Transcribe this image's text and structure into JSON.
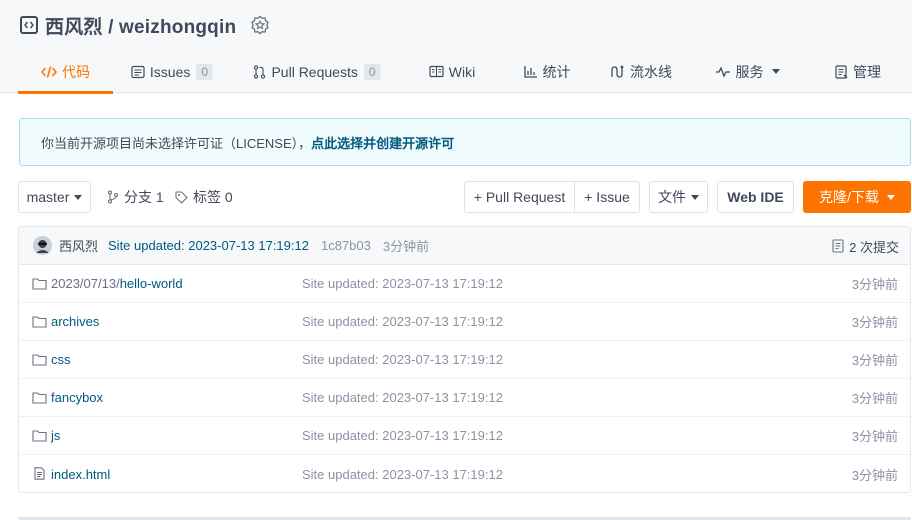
{
  "repo": {
    "title": "西风烈 / weizhongqin"
  },
  "tabs": [
    {
      "label": "代码",
      "icon": "code-icon",
      "active": true
    },
    {
      "label": "Issues",
      "icon": "issues-icon",
      "count": "0"
    },
    {
      "label": "Pull Requests",
      "icon": "pull-request-icon",
      "count": "0"
    },
    {
      "label": "Wiki",
      "icon": "wiki-icon"
    },
    {
      "label": "统计",
      "icon": "stats-icon"
    },
    {
      "label": "流水线",
      "icon": "pipeline-icon"
    },
    {
      "label": "服务",
      "icon": "service-icon"
    },
    {
      "label": "管理",
      "icon": "manage-icon"
    }
  ],
  "notice": {
    "text": "你当前开源项目尚未选择许可证（LICENSE），",
    "link": "点此选择并创建开源许可"
  },
  "toolbar": {
    "branch": "master",
    "branches": "分支 1",
    "tags": "标签 0",
    "pull_request": "+ Pull Request",
    "issue": "+ Issue",
    "file": "文件",
    "web_ide": "Web IDE",
    "clone": "克隆/下载"
  },
  "commit": {
    "author": "西风烈",
    "message": "Site updated: 2023-07-13 17:19:12",
    "sha": "1c87b03",
    "time": "3分钟前",
    "count": "2 次提交"
  },
  "files": [
    {
      "prefix": "2023/07/13/",
      "name": "hello-world",
      "type": "folder",
      "message": "Site updated: 2023-07-13 17:19:12",
      "time": "3分钟前"
    },
    {
      "prefix": "",
      "name": "archives",
      "type": "folder",
      "message": "Site updated: 2023-07-13 17:19:12",
      "time": "3分钟前"
    },
    {
      "prefix": "",
      "name": "css",
      "type": "folder",
      "message": "Site updated: 2023-07-13 17:19:12",
      "time": "3分钟前"
    },
    {
      "prefix": "",
      "name": "fancybox",
      "type": "folder",
      "message": "Site updated: 2023-07-13 17:19:12",
      "time": "3分钟前"
    },
    {
      "prefix": "",
      "name": "js",
      "type": "folder",
      "message": "Site updated: 2023-07-13 17:19:12",
      "time": "3分钟前"
    },
    {
      "prefix": "",
      "name": "index.html",
      "type": "file",
      "message": "Site updated: 2023-07-13 17:19:12",
      "time": "3分钟前"
    }
  ],
  "colors": {
    "accent": "#fe7300",
    "link": "#005980",
    "notice_bg": "#f0fbfd"
  }
}
